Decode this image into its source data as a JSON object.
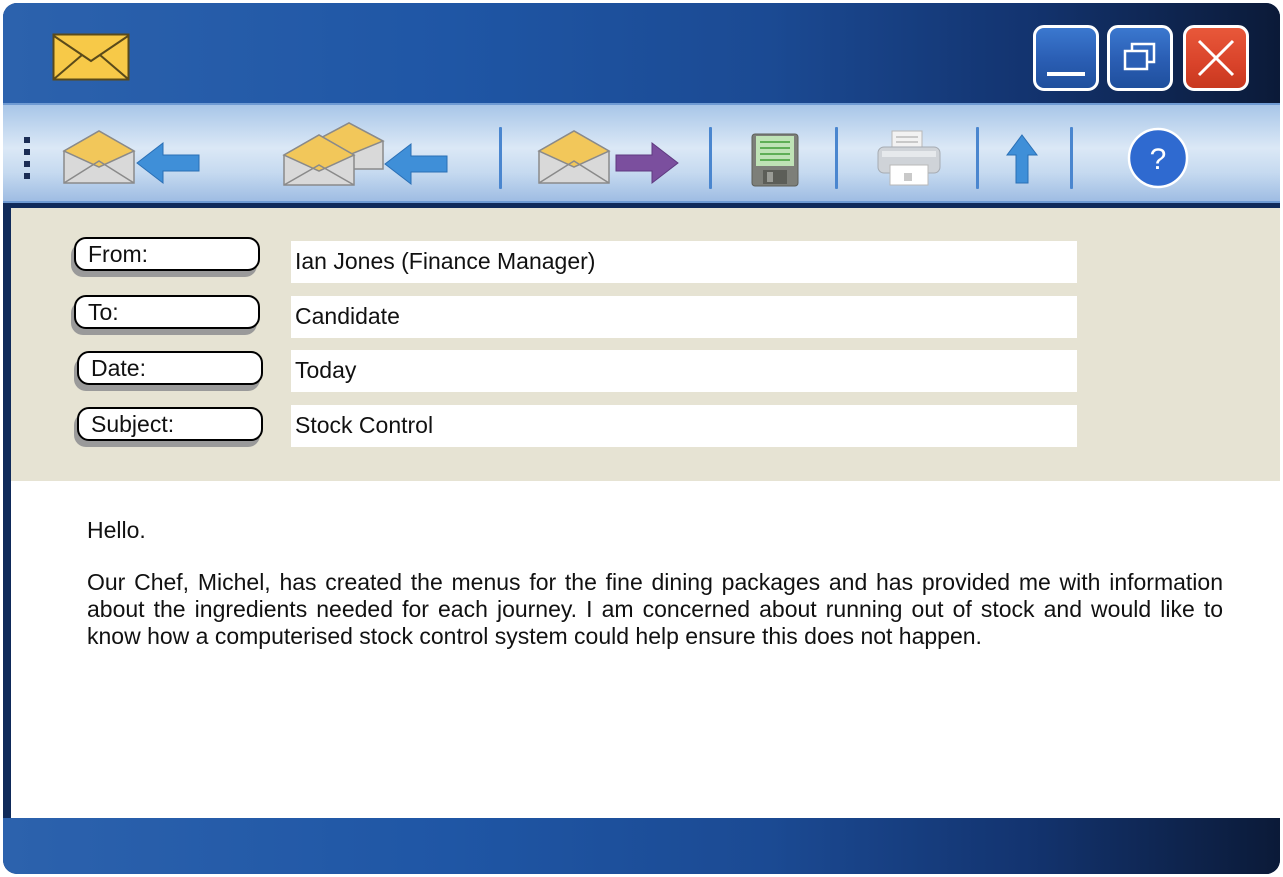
{
  "window": {
    "buttons": {
      "minimize_icon": "minimize-icon",
      "restore_icon": "restore-icon",
      "close_icon": "close-icon"
    }
  },
  "toolbar": {
    "tools": [
      {
        "id": "reply",
        "icon": "reply-envelope-icon"
      },
      {
        "id": "reply-all",
        "icon": "reply-all-envelope-icon"
      },
      {
        "id": "forward",
        "icon": "forward-envelope-icon"
      },
      {
        "id": "save",
        "icon": "floppy-disk-icon"
      },
      {
        "id": "print",
        "icon": "printer-icon"
      },
      {
        "id": "up",
        "icon": "arrow-up-icon"
      },
      {
        "id": "help",
        "icon": "help-icon",
        "label": "?"
      }
    ]
  },
  "header": {
    "fields": [
      {
        "label": "From:",
        "value": "Ian Jones (Finance Manager)"
      },
      {
        "label": "To:",
        "value": "Candidate"
      },
      {
        "label": "Date:",
        "value": "Today"
      },
      {
        "label": "Subject:",
        "value": "Stock Control"
      }
    ]
  },
  "message": {
    "greeting": "Hello.",
    "body": "Our Chef, Michel, has created the menus for the fine dining packages and has provided me with information about the ingredients needed for each journey. I am concerned about running out of stock and would like to know how a computerised stock control system could help ensure this does not happen."
  },
  "colors": {
    "titlebar_blue": "#1f56a5",
    "toolbar_blue": "#a8c6e8",
    "header_beige": "#e6e3d3",
    "close_red": "#d9432a",
    "arrow_blue": "#3f8fd8",
    "arrow_purple": "#7b4f9e"
  }
}
